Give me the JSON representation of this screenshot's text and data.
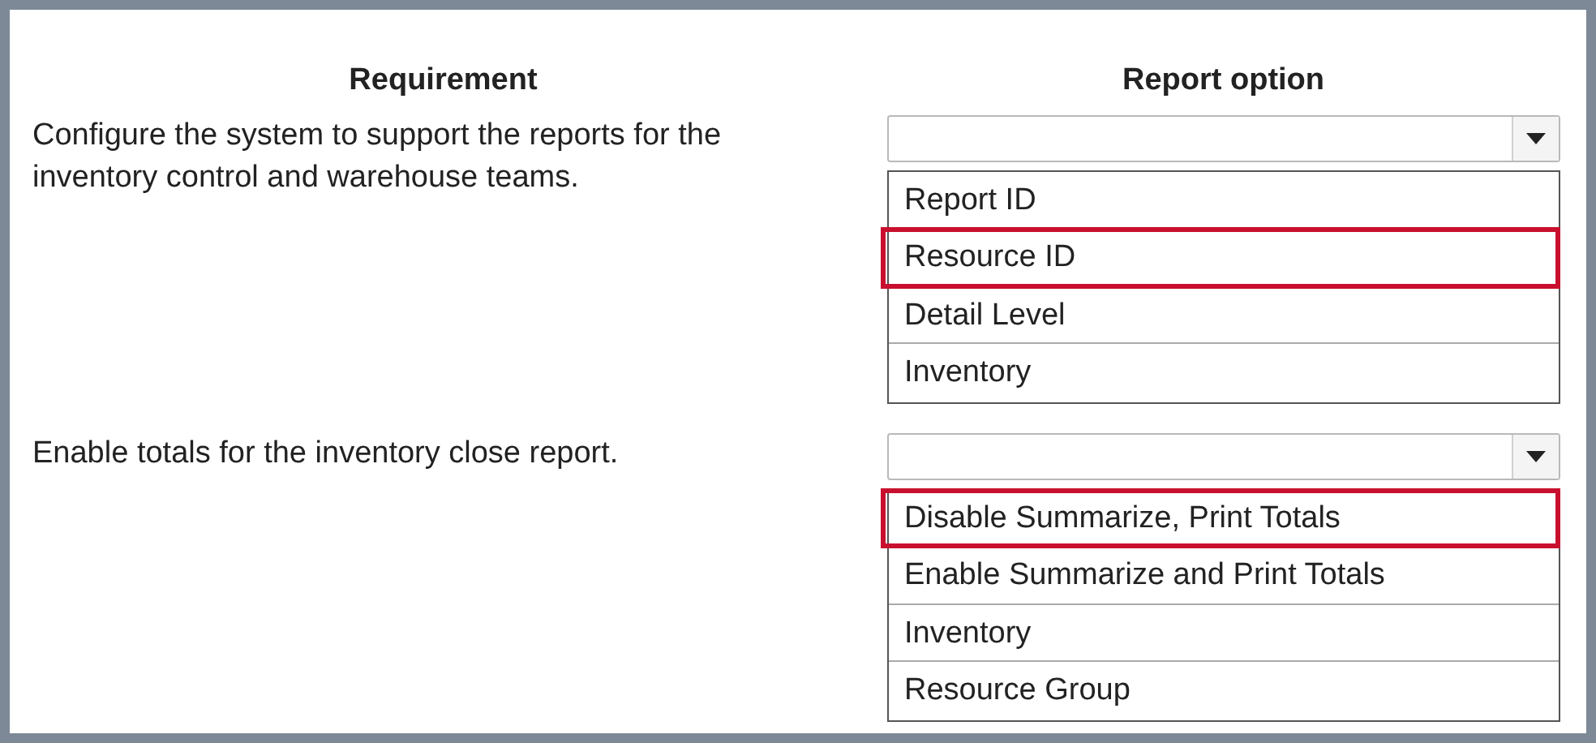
{
  "columns": [
    "Requirement",
    "Report option"
  ],
  "rows": [
    {
      "requirement": "Configure the system to support the reports for the inventory control and warehouse teams.",
      "options": [
        {
          "label": "Report ID",
          "selected": false
        },
        {
          "label": "Resource ID",
          "selected": true
        },
        {
          "label": "Detail Level",
          "selected": false
        },
        {
          "label": "Inventory",
          "selected": false
        }
      ]
    },
    {
      "requirement": "Enable totals for the inventory close report.",
      "options": [
        {
          "label": "Disable Summarize, Print Totals",
          "selected": true
        },
        {
          "label": "Enable Summarize and Print Totals",
          "selected": false
        },
        {
          "label": "Inventory",
          "selected": false
        },
        {
          "label": "Resource Group",
          "selected": false
        }
      ]
    }
  ]
}
